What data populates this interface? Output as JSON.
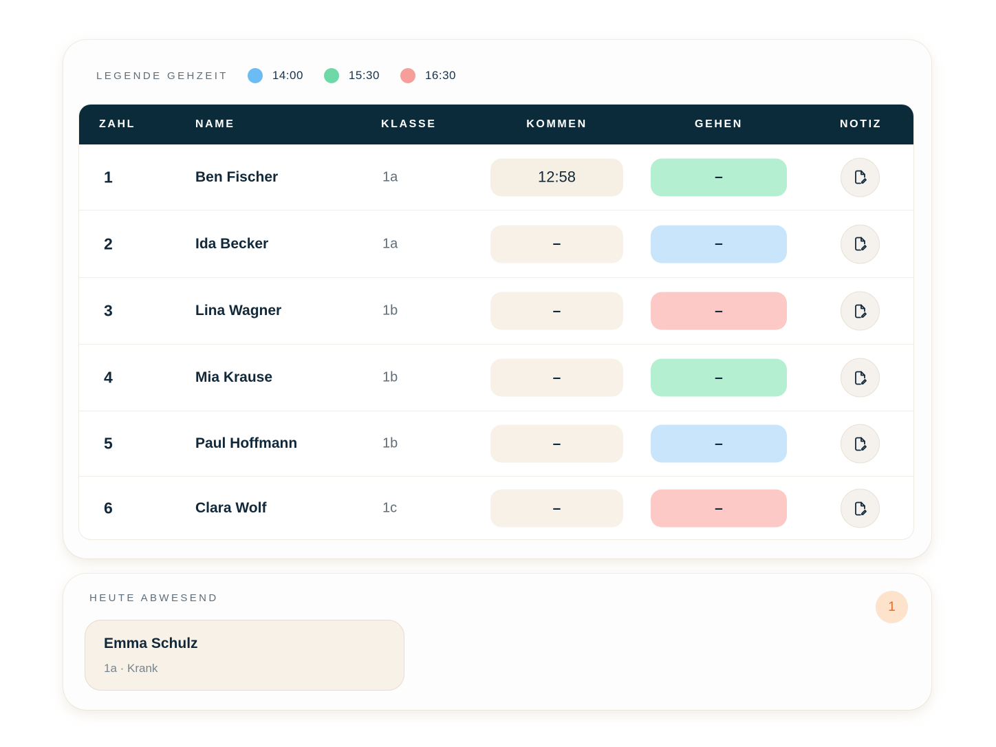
{
  "legend": {
    "title": "LEGENDE GEHZEIT",
    "items": [
      {
        "label": "14:00",
        "color": "#6bbcf4"
      },
      {
        "label": "15:30",
        "color": "#6ed9a6"
      },
      {
        "label": "16:30",
        "color": "#f69e9a"
      }
    ]
  },
  "table": {
    "headers": {
      "zahl": "ZAHL",
      "name": "NAME",
      "klasse": "KLASSE",
      "kommen": "KOMMEN",
      "gehen": "GEHEN",
      "notiz": "NOTIZ"
    },
    "rows": [
      {
        "zahl": "1",
        "name": "Ben Fischer",
        "klasse": "1a",
        "kommen": "12:58",
        "gehen": "–",
        "gehen_color": "#b4efd2"
      },
      {
        "zahl": "2",
        "name": "Ida Becker",
        "klasse": "1a",
        "kommen": "–",
        "gehen": "–",
        "gehen_color": "#c8e5fb"
      },
      {
        "zahl": "3",
        "name": "Lina Wagner",
        "klasse": "1b",
        "kommen": "–",
        "gehen": "–",
        "gehen_color": "#fdc9c7"
      },
      {
        "zahl": "4",
        "name": "Mia Krause",
        "klasse": "1b",
        "kommen": "–",
        "gehen": "–",
        "gehen_color": "#b4efd2"
      },
      {
        "zahl": "5",
        "name": "Paul Hoffmann",
        "klasse": "1b",
        "kommen": "–",
        "gehen": "–",
        "gehen_color": "#c8e5fb"
      },
      {
        "zahl": "6",
        "name": "Clara Wolf",
        "klasse": "1c",
        "kommen": "–",
        "gehen": "–",
        "gehen_color": "#fdc9c7"
      }
    ],
    "note_icon": "note-edit-icon"
  },
  "absent": {
    "title": "HEUTE ABWESEND",
    "count": "1",
    "entries": [
      {
        "name": "Emma Schulz",
        "meta": "1a · Krank"
      }
    ]
  }
}
